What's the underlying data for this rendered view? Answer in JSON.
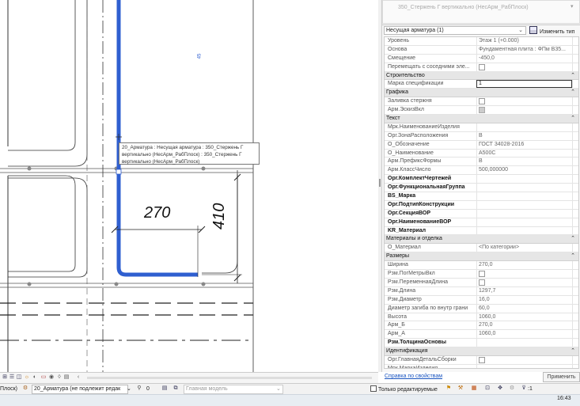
{
  "canvas": {
    "dimensions": {
      "width_270": "270",
      "height_410": "410"
    },
    "tooltip": {
      "line1": "20_Арматура : Несущая арматура : 350_Стержень Г",
      "line2": "вертикально (НесАрм_РабПлоск) : 350_Стержень Г",
      "line3": "вертикально (НесАрм_РабПлоск)"
    },
    "bar_label": "45"
  },
  "properties": {
    "type_name": "350_Стержень Г вертикально (НесАрм_РабПлоск)",
    "instance_selector": "Несущая арматура (1)",
    "edit_type_label": "Изменить тип",
    "top_rows": [
      {
        "name": "Уровень",
        "value": "Этаж 1 (+0.000)"
      },
      {
        "name": "Основа",
        "value": "Фундаментная плита : ФПм В35..."
      },
      {
        "name": "Смещение",
        "value": "-450,0"
      },
      {
        "name": "Перемещать с соседними эле...",
        "value": "",
        "checkbox": true
      }
    ],
    "groups": [
      {
        "title": "Строительство",
        "collapse": "⌃",
        "rows": [
          {
            "name": "Марка спецификации",
            "value": "1",
            "edit": true,
            "bold": false
          }
        ]
      },
      {
        "title": "Графика",
        "collapse": "⌃",
        "rows": [
          {
            "name": "Заливка стержня",
            "value": "",
            "checkbox": true
          },
          {
            "name": "Арм.ЭскизВкл",
            "value": "",
            "checkbox": true,
            "disabled": true
          }
        ]
      },
      {
        "title": "Текст",
        "collapse": "⌃",
        "rows": [
          {
            "name": "Мрк.НаименованиеИзделия",
            "value": ""
          },
          {
            "name": "Орг.ЗонаРасположения",
            "value": "В"
          },
          {
            "name": "О_Обозначение",
            "value": "ГОСТ 34028-2016"
          },
          {
            "name": "О_Наименование",
            "value": "А500С"
          },
          {
            "name": "Арм.ПрефиксФормы",
            "value": "В"
          },
          {
            "name": "Арм.КлассЧисло",
            "value": "500,000000"
          },
          {
            "name": "Орг.КомплектЧертежей",
            "value": "",
            "bold": true
          },
          {
            "name": "Орг.ФункциональнаяГруппа",
            "value": "",
            "bold": true
          },
          {
            "name": "BS_Марка",
            "value": "",
            "bold": true
          },
          {
            "name": "Орг.ПодтипКонструкции",
            "value": "",
            "bold": true
          },
          {
            "name": "Орг.СекцияВОР",
            "value": "",
            "bold": true
          },
          {
            "name": "Орг.НаименованиеВОР",
            "value": "",
            "bold": true
          },
          {
            "name": "KR_Материал",
            "value": "",
            "bold": true
          }
        ]
      },
      {
        "title": "Материалы и отделка",
        "collapse": "⌃",
        "rows": [
          {
            "name": "О_Материал",
            "value": "<По категории>"
          }
        ]
      },
      {
        "title": "Размеры",
        "collapse": "⌃",
        "rows": [
          {
            "name": "Ширина",
            "value": "270,0"
          },
          {
            "name": "Рзм.ПогМетрыВкл",
            "value": "",
            "checkbox": true
          },
          {
            "name": "Рзм.ПеременнаяДлина",
            "value": "",
            "checkbox": true
          },
          {
            "name": "Рзм.Длина",
            "value": "1297,7"
          },
          {
            "name": "Рзм.Диаметр",
            "value": "16,0"
          },
          {
            "name": "Диаметр загиба по внутр грани",
            "value": "60,0"
          },
          {
            "name": "Высота",
            "value": "1060,0"
          },
          {
            "name": "Арм_Б",
            "value": "270,0"
          },
          {
            "name": "Арм_А",
            "value": "1060,0"
          },
          {
            "name": "Рзм.ТолщинаОсновы",
            "value": "",
            "bold": true
          }
        ]
      },
      {
        "title": "Идентификация",
        "collapse": "⌃",
        "rows": [
          {
            "name": "Орг.ГлавнаяДетальСборки",
            "value": "",
            "checkbox": true
          },
          {
            "name": "Мрк.МаркаИзделия",
            "value": ""
          }
        ]
      }
    ],
    "help_link": "Справка по свойствам",
    "apply_label": "Применить"
  },
  "statusbar": {
    "left_fragment": "Плоск)",
    "family_selector": "20_Арматура (не подлежит редак",
    "counter": "0",
    "model_selector": "Главная модель",
    "only_editable": "Только редактируемые",
    "filter_count": ":1"
  },
  "taskbar": {
    "time": "16:43"
  }
}
